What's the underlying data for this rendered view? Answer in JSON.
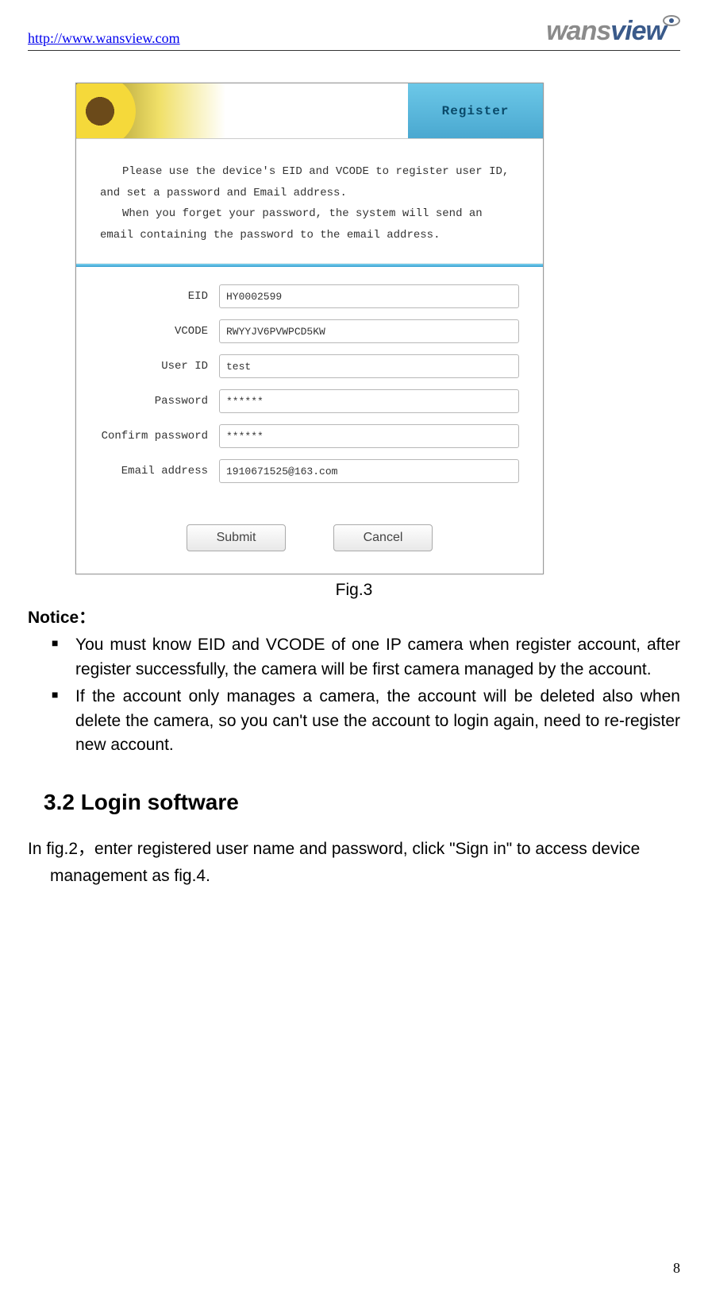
{
  "header": {
    "url": "http://www.wansview.com",
    "brand_part1": "wans",
    "brand_part2": "view"
  },
  "register": {
    "title": "Register",
    "instruction_p1": "Please use the device's EID and VCODE to register user ID, and set a password and Email address.",
    "instruction_p2": "When you forget your password, the system will send an email containing the password to the email address.",
    "fields": {
      "eid_label": "EID",
      "eid_value": "HY0002599",
      "vcode_label": "VCODE",
      "vcode_value": "RWYYJV6PVWPCD5KW",
      "userid_label": "User ID",
      "userid_value": "test",
      "password_label": "Password",
      "password_value": "******",
      "confirm_label": "Confirm password",
      "confirm_value": "******",
      "email_label": "Email address",
      "email_value": "1910671525@163.com"
    },
    "submit_label": "Submit",
    "cancel_label": "Cancel"
  },
  "figure_caption": "Fig.3",
  "notice_heading": "Notice：",
  "notice_items": [
    "You must know EID and VCODE of one IP camera when register account, after register successfully, the camera will be first camera managed by the account.",
    "If the account only manages a camera, the account will be deleted also when delete the camera, so you can't use the account to login again, need to re-register new account."
  ],
  "section_heading": "3.2 Login software",
  "body_line1": "In fig.2，enter registered user name and password, click \"Sign in\" to access device",
  "body_line2": "management as fig.4.",
  "page_number": "8"
}
